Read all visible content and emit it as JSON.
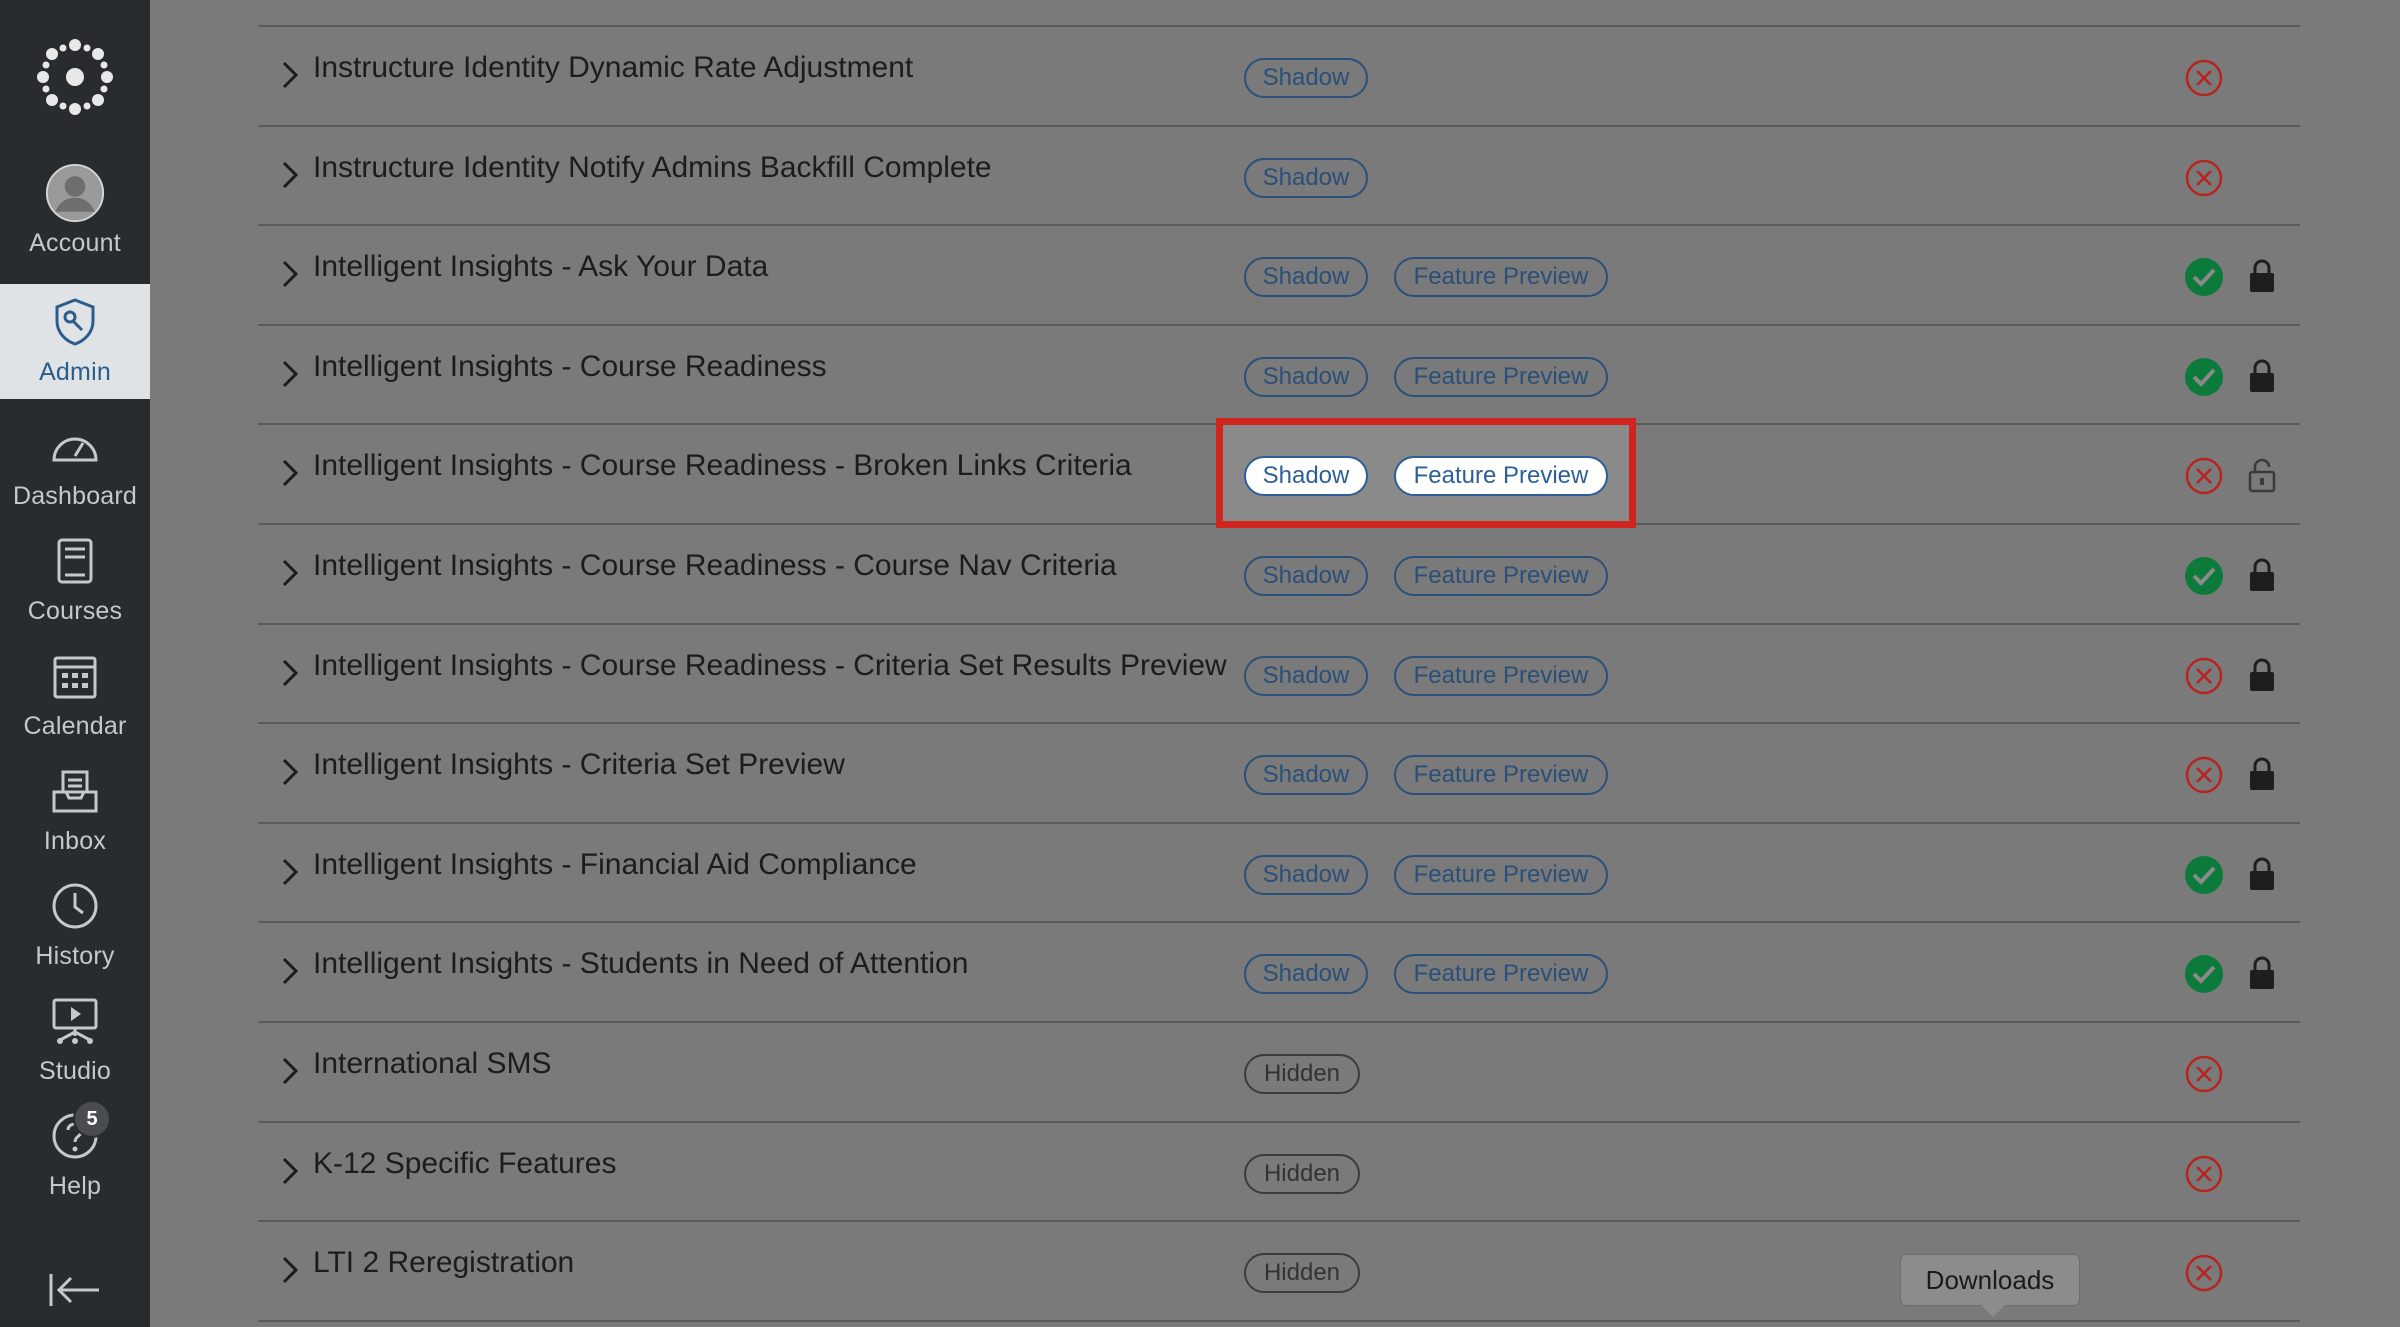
{
  "nav": {
    "items": [
      {
        "key": "account",
        "label": "Account",
        "icon": "account-icon"
      },
      {
        "key": "admin",
        "label": "Admin",
        "icon": "admin-icon"
      },
      {
        "key": "dashboard",
        "label": "Dashboard",
        "icon": "dashboard-icon"
      },
      {
        "key": "courses",
        "label": "Courses",
        "icon": "courses-icon"
      },
      {
        "key": "calendar",
        "label": "Calendar",
        "icon": "calendar-icon"
      },
      {
        "key": "inbox",
        "label": "Inbox",
        "icon": "inbox-icon"
      },
      {
        "key": "history",
        "label": "History",
        "icon": "history-icon"
      },
      {
        "key": "studio",
        "label": "Studio",
        "icon": "studio-icon"
      },
      {
        "key": "help",
        "label": "Help",
        "icon": "help-icon"
      }
    ],
    "help_badge": "5",
    "active": "admin"
  },
  "features": [
    {
      "title": "Instructure Identity Dynamic Rate Adjustment",
      "pills": [
        "Shadow"
      ],
      "status": "off",
      "lock": "none"
    },
    {
      "title": "Instructure Identity Notify Admins Backfill Complete",
      "pills": [
        "Shadow"
      ],
      "status": "off",
      "lock": "none"
    },
    {
      "title": "Intelligent Insights - Ask Your Data",
      "pills": [
        "Shadow",
        "Feature Preview"
      ],
      "status": "on",
      "lock": "locked"
    },
    {
      "title": "Intelligent Insights - Course Readiness",
      "pills": [
        "Shadow",
        "Feature Preview"
      ],
      "status": "on",
      "lock": "locked"
    },
    {
      "title": "Intelligent Insights - Course Readiness - Broken Links Criteria",
      "pills": [
        "Shadow",
        "Feature Preview"
      ],
      "status": "off",
      "lock": "unlocked",
      "highlighted": true
    },
    {
      "title": "Intelligent Insights - Course Readiness - Course Nav Criteria",
      "pills": [
        "Shadow",
        "Feature Preview"
      ],
      "status": "on",
      "lock": "locked"
    },
    {
      "title": "Intelligent Insights - Course Readiness - Criteria Set Results Preview",
      "pills": [
        "Shadow",
        "Feature Preview"
      ],
      "status": "off",
      "lock": "locked"
    },
    {
      "title": "Intelligent Insights - Criteria Set Preview",
      "pills": [
        "Shadow",
        "Feature Preview"
      ],
      "status": "off",
      "lock": "locked"
    },
    {
      "title": "Intelligent Insights - Financial Aid Compliance",
      "pills": [
        "Shadow",
        "Feature Preview"
      ],
      "status": "on",
      "lock": "locked"
    },
    {
      "title": "Intelligent Insights - Students in Need of Attention",
      "pills": [
        "Shadow",
        "Feature Preview"
      ],
      "status": "on",
      "lock": "locked"
    },
    {
      "title": "International SMS",
      "pills": [
        "Hidden"
      ],
      "status": "off",
      "lock": "none"
    },
    {
      "title": "K-12 Specific Features",
      "pills": [
        "Hidden"
      ],
      "status": "off",
      "lock": "none"
    },
    {
      "title": "LTI 2 Reregistration",
      "pills": [
        "Hidden"
      ],
      "status": "off",
      "lock": "none"
    }
  ],
  "tooltip": {
    "label": "Downloads"
  },
  "colors": {
    "nav_bg": "#282c2f",
    "on_green": "#0b7a3b",
    "off_red": "#b8231d",
    "pill_blue": "#2a4f78",
    "highlight_red": "#d0251f"
  }
}
